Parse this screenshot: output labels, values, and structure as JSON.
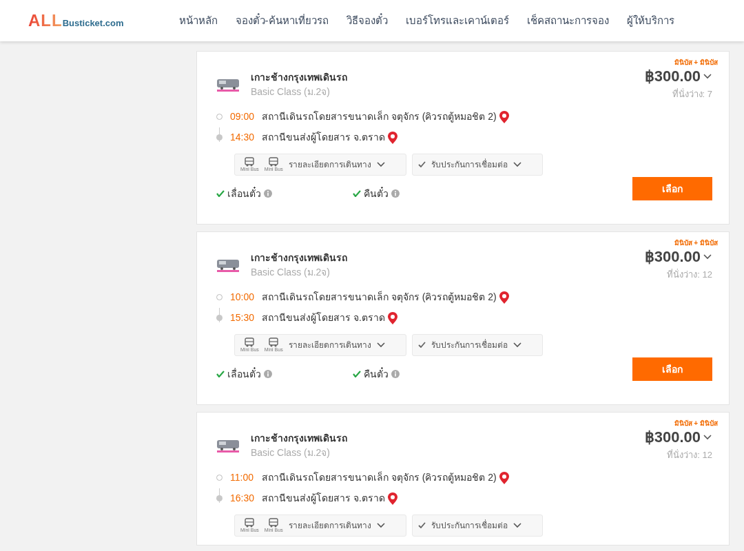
{
  "header": {
    "logo": {
      "main": "ALL",
      "sub": "Busticket.com"
    },
    "nav": [
      {
        "label": "หน้าหลัก"
      },
      {
        "label": "จองตั๋ว-ค้นหาเที่ยวรถ"
      },
      {
        "label": "วิธีจองตั๋ว"
      },
      {
        "label": "เบอร์โทรและเคาน์เตอร์"
      },
      {
        "label": "เช็คสถานะการจอง"
      },
      {
        "label": "ผู้ให้บริการ"
      }
    ]
  },
  "trips": [
    {
      "tag": "มินิบัส + มินิบัส",
      "operator": "เกาะช้างกรุงเทพเดินรถ",
      "class": "Basic Class (ม.2จ)",
      "price": "฿300.00",
      "seats": "ที่นั่งว่าง: 7",
      "stops": [
        {
          "kind": "departure",
          "time": "09:00",
          "station": "สถานีเดินรถโดยสารขนาดเล็ก จตุจักร (คิวรถตู้หมอชิต 2)"
        },
        {
          "kind": "arrival",
          "time": "14:30",
          "station": "สถานีขนส่งผู้โดยสาร จ.ตราด"
        }
      ],
      "vehicles": [
        "Mini Bus",
        "Mini Bus"
      ],
      "details": "รายละเอียดการเดินทาง",
      "insurance": "รับประกันการเชื่อมต่อ",
      "features": [
        {
          "label": "เลื่อนตั๋ว",
          "checked": true
        },
        {
          "label": "คืนตั๋ว",
          "checked": true
        }
      ],
      "select": "เลือก"
    },
    {
      "tag": "มินิบัส + มินิบัส",
      "operator": "เกาะช้างกรุงเทพเดินรถ",
      "class": "Basic Class (ม.2จ)",
      "price": "฿300.00",
      "seats": "ที่นั่งว่าง: 12",
      "stops": [
        {
          "kind": "departure",
          "time": "10:00",
          "station": "สถานีเดินรถโดยสารขนาดเล็ก จตุจักร (คิวรถตู้หมอชิต 2)"
        },
        {
          "kind": "arrival",
          "time": "15:30",
          "station": "สถานีขนส่งผู้โดยสาร จ.ตราด"
        }
      ],
      "vehicles": [
        "Mini Bus",
        "Mini Bus"
      ],
      "details": "รายละเอียดการเดินทาง",
      "insurance": "รับประกันการเชื่อมต่อ",
      "features": [
        {
          "label": "เลื่อนตั๋ว",
          "checked": true
        },
        {
          "label": "คืนตั๋ว",
          "checked": true
        }
      ],
      "select": "เลือก"
    },
    {
      "tag": "มินิบัส + มินิบัส",
      "operator": "เกาะช้างกรุงเทพเดินรถ",
      "class": "Basic Class (ม.2จ)",
      "price": "฿300.00",
      "seats": "ที่นั่งว่าง: 12",
      "stops": [
        {
          "kind": "departure",
          "time": "11:00",
          "station": "สถานีเดินรถโดยสารขนาดเล็ก จตุจักร (คิวรถตู้หมอชิต 2)"
        },
        {
          "kind": "arrival",
          "time": "16:30",
          "station": "สถานีขนส่งผู้โดยสาร จ.ตราด"
        }
      ],
      "vehicles": [
        "Mini Bus",
        "Mini Bus"
      ],
      "details": "รายละเอียดการเดินทาง",
      "insurance": "รับประกันการเชื่อมต่อ"
    }
  ]
}
